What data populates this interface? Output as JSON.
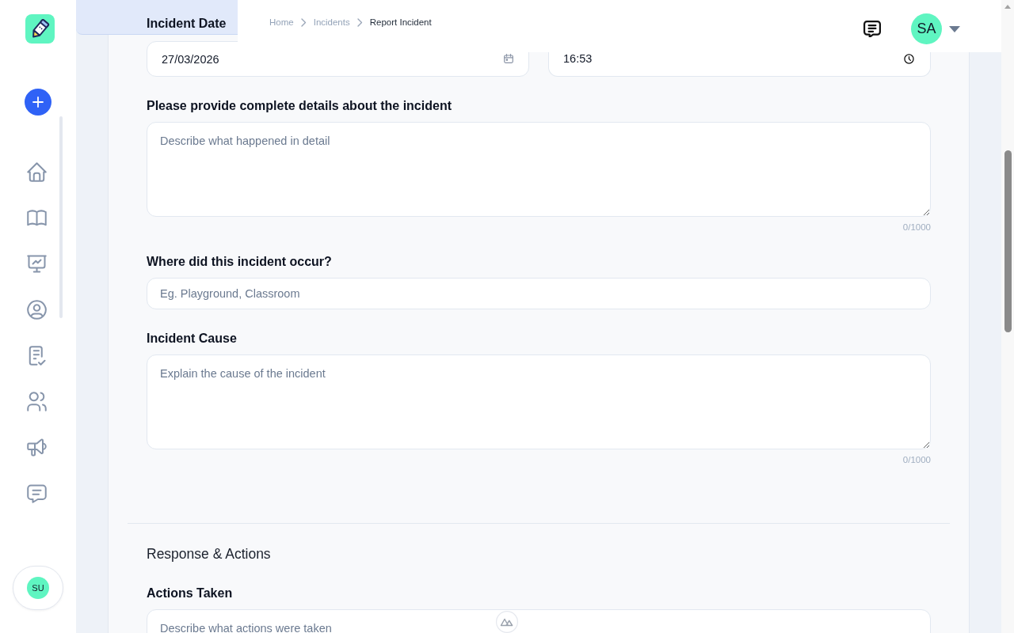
{
  "header": {
    "breadcrumbs": [
      {
        "label": "Home",
        "current": false
      },
      {
        "label": "Incidents",
        "current": false
      },
      {
        "label": "Report Incident",
        "current": true
      }
    ],
    "user_initials": "SA"
  },
  "sidebar": {
    "user_initials": "SU"
  },
  "form": {
    "date_row": {
      "label": "Incident Date",
      "date": "27/03/2026",
      "time": "16:53"
    },
    "fields": [
      {
        "kind": "textarea",
        "label": "Please provide complete details about the incident",
        "placeholder": "Describe what happened in detail",
        "counter": "0/1000"
      },
      {
        "kind": "input",
        "label": "Where did this incident occur?",
        "placeholder": "Eg. Playground, Classroom"
      },
      {
        "kind": "textarea",
        "label": "Incident Cause",
        "placeholder": "Explain the cause of the incident",
        "counter": "0/1000"
      }
    ]
  },
  "response_section": {
    "title": "Response & Actions",
    "fields": [
      {
        "kind": "textarea",
        "label": "Actions Taken",
        "placeholder": "Describe what actions were taken"
      }
    ]
  }
}
